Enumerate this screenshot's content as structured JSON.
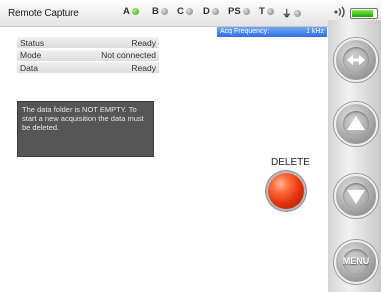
{
  "app": {
    "title": "Remote Capture"
  },
  "channels": [
    {
      "label": "A",
      "status": "green"
    },
    {
      "label": "B",
      "status": "grey"
    },
    {
      "label": "C",
      "status": "grey"
    },
    {
      "label": "D",
      "status": "grey"
    },
    {
      "label": "PS",
      "status": "grey"
    },
    {
      "label": "T",
      "status": "grey"
    },
    {
      "label": "⏚",
      "status": "grey"
    }
  ],
  "status_bar": {
    "wifi_icon": "wifi-icon",
    "battery_level": 0.88
  },
  "status_table": {
    "rows": [
      {
        "label": "Status",
        "value": "Ready"
      },
      {
        "label": "Mode",
        "value": "Not connected"
      },
      {
        "label": "Data",
        "value": "Ready"
      }
    ]
  },
  "message": {
    "text": "The data folder is NOT EMPTY. To start a new acquisition the data must be deleted."
  },
  "frequency": {
    "label": "Acq Frequency:",
    "value": "1 kHz"
  },
  "delete": {
    "label": "DELETE"
  },
  "side_buttons": {
    "menu_label": "MENU"
  },
  "colors": {
    "accent_blue": "#3b7ff0",
    "delete_red": "#e0300a",
    "message_bg": "#555555"
  }
}
